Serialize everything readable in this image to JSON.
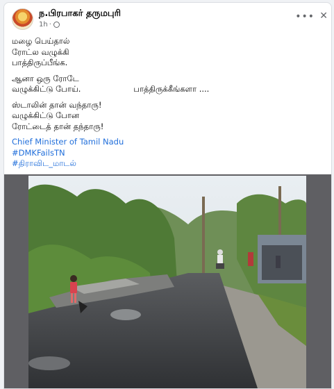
{
  "post": {
    "author": "ந.பிரபாகர் தருமபுரி",
    "time": "1h",
    "icons": {
      "privacy": "globe-icon",
      "more": "more-options-icon",
      "close": "close-icon"
    },
    "lines": {
      "l1": "மழை பெய்தால்",
      "l2": "ரோட்ல வழுக்கி",
      "l3": "பாத்திருப்பீங்க.",
      "l4": "ஆனா ஒரு ரோடே",
      "l5a": "வழுக்கிட்டு போய்.",
      "l5b": "பாத்திருக்கீங்களா ....",
      "l6": "ஸ்டாலின் தான் வந்தாரு!",
      "l7": "வழுக்கிட்டு போன",
      "l8": "ரோட்டைத் தான் தந்தாரு!"
    },
    "hashtags": {
      "h1": "Chief Minister of Tamil Nadu",
      "h2": "#DMKFailsTN",
      "h3": "#திராவிட_மாடல்"
    }
  },
  "colors": {
    "link": "#216fdb",
    "media_bg": "#5f5f63"
  }
}
